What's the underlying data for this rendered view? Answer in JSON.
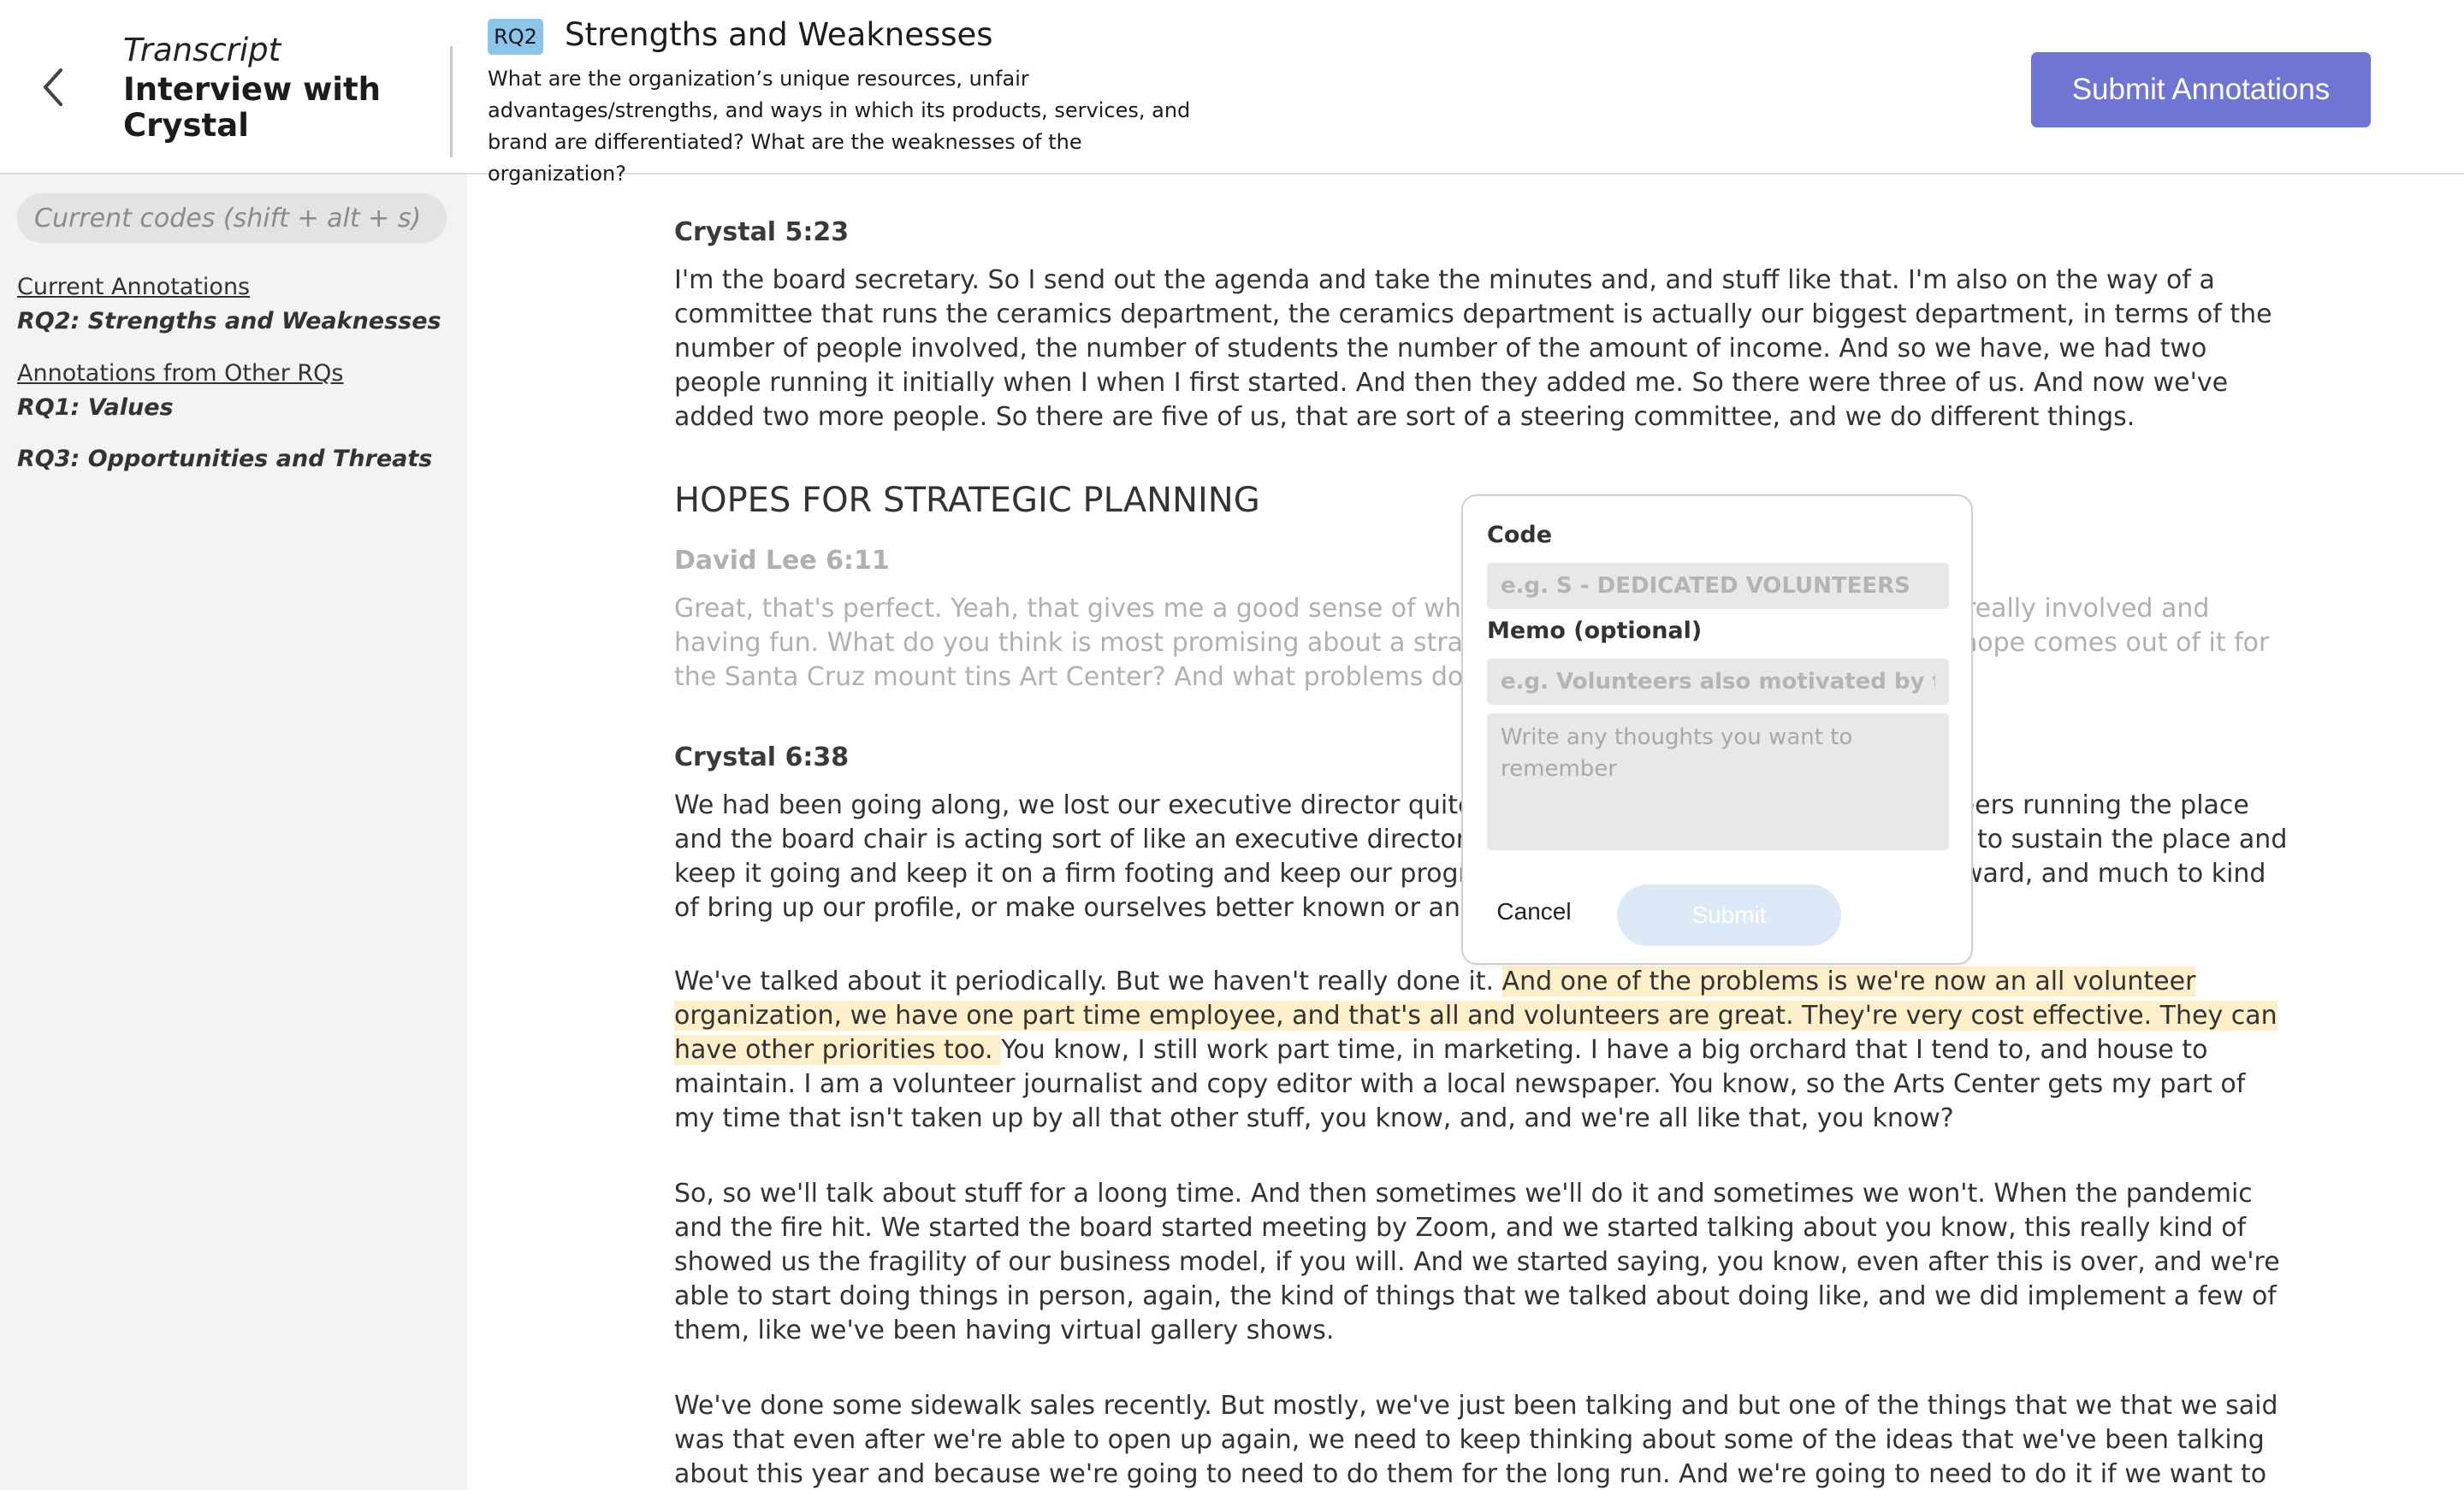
{
  "header": {
    "back_icon": "chevron-left-icon",
    "title_kicker": "Transcript",
    "title": "Interview with Crystal",
    "rq_badge": "RQ2",
    "rq_title": "Strengths and Weaknesses",
    "rq_description": "What are the organization’s unique resources, unfair advantages/strengths, and ways in which its products, services, and brand are differentiated? What are the weaknesses of the organization?",
    "submit_label": "Submit Annotations",
    "submit_color": "#7074d3"
  },
  "sidebar": {
    "search_placeholder": "Current codes (shift + alt + s)",
    "current_heading": "Current Annotations",
    "current_items": [
      "RQ2: Strengths and Weaknesses"
    ],
    "other_heading": "Annotations from Other RQs",
    "other_items": [
      "RQ1: Values",
      "RQ3: Opportunities and Threats"
    ]
  },
  "transcript": {
    "blocks": [
      {
        "speaker": "Crystal 5:23",
        "text": "I'm the board secretary. So I send out the agenda and take the minutes and, and stuff like that. I'm also on the way of a committee that runs the ceramics department, the ceramics department is actually our biggest department, in terms of the number of people involved, the number of students the number of the amount of income. And so we have, we had two people running it initially when I when I first started. And then they added me. So there were three of us. And now we've added two more people. So there are five of us, that are sort of a steering committee, and we do different things."
      },
      {
        "heading": "HOPES FOR STRATEGIC PLANNING"
      },
      {
        "speaker": "David Lee 6:11",
        "faded": true,
        "text": "Great, that's perfect. Yeah, that gives me a good sense of what's going on, and it sounds like you're really involved and having fun. What do you think is most promising about a strategic planning effort? What would you hope comes out of it for the Santa Cruz mount tins Art Center? And what problems do you hope addresses?"
      },
      {
        "speaker": "Crystal 6:38",
        "text": "We had been going along, we lost our executive director quite a while ago, and so we've had volunteers running the place and the board chair is acting sort of like an executive director, but she's a volunteer too. So we need to sustain the place and keep it going and keep it on a firm footing and keep our programs going, and we'd like to grow it forward, and much to kind of bring up our profile, or make ourselves better known or anything like that."
      },
      {
        "pre": "We've talked about it periodically. But we haven't really done it. ",
        "highlight": "And one of the problems is we're now an all volunteer organization, we have one part time employee, and that's all and volunteers are great. They're very cost effective. They can have other priorities too. ",
        "post": "You know, I still work part time, in marketing. I have a big orchard that I tend to, and house to maintain. I am a volunteer journalist and copy editor with a local newspaper. You know, so the Arts Center gets my part of my time that isn't taken up by all that other stuff, you know, and, and we're all like that, you know?"
      },
      {
        "text": "So, so we'll talk about stuff for a loong time. And then sometimes we'll do it and sometimes we won't. When the pandemic and the fire hit. We started the board started meeting by Zoom, and we started talking about you know, this really kind of showed us the fragility of our business model, if you will. And we started saying, you know, even after this is over, and we're able to start doing things in person, again, the kind of things that we talked about doing like, and we did implement a few of them, like we've been having virtual gallery shows."
      },
      {
        "text": "We've done some sidewalk sales recently. But mostly, we've just been talking and but one of the things that we that we said was that even after we're able to open up again, we need to keep thinking about some of the ideas that we've been talking about this year and because we're going to need to do them for the long run. And we're going to need to do it if we want to raise our veil"
      }
    ],
    "highlight_color": "#fdefc9"
  },
  "popup": {
    "code_label": "Code",
    "code_placeholder": "e.g. S - DEDICATED VOLUNTEERS",
    "memo_label": "Memo (optional)",
    "memo_placeholder": "e.g. Volunteers also motivated by food",
    "thoughts_placeholder": "Write any thoughts you want to remember",
    "cancel_label": "Cancel",
    "submit_label": "Submit",
    "submit_color": "#dceaf8"
  }
}
